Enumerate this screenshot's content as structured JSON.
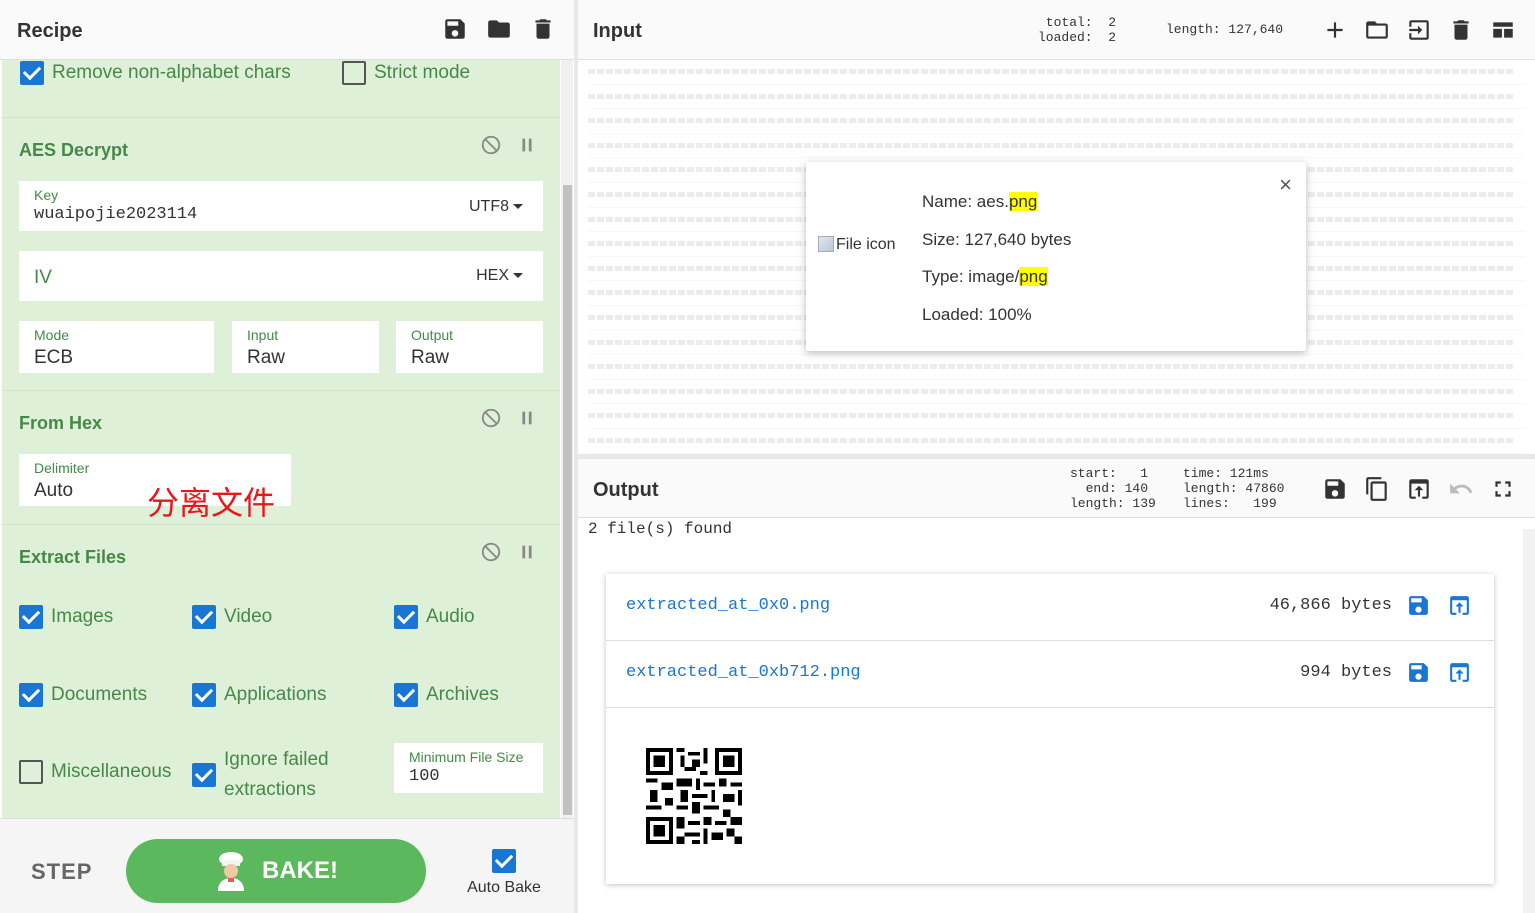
{
  "recipe": {
    "title": "Recipe",
    "top_checks": [
      {
        "label": "Remove non-alphabet chars",
        "checked": true
      },
      {
        "label": "Strict mode",
        "checked": false
      }
    ],
    "aes": {
      "title": "AES Decrypt",
      "key_label": "Key",
      "key_value": "wuaipojie2023114",
      "key_encoding": "UTF8",
      "iv_label": "IV",
      "iv_encoding": "HEX",
      "mode_label": "Mode",
      "mode_value": "ECB",
      "input_label": "Input",
      "input_value": "Raw",
      "output_label": "Output",
      "output_value": "Raw"
    },
    "from_hex": {
      "title": "From Hex",
      "delimiter_label": "Delimiter",
      "delimiter_value": "Auto"
    },
    "extract": {
      "title": "Extract Files",
      "annotation": "分离文件",
      "options": [
        {
          "label": "Images",
          "checked": true
        },
        {
          "label": "Video",
          "checked": true
        },
        {
          "label": "Audio",
          "checked": true
        },
        {
          "label": "Documents",
          "checked": true
        },
        {
          "label": "Applications",
          "checked": true
        },
        {
          "label": "Archives",
          "checked": true
        },
        {
          "label": "Miscellaneous",
          "checked": false
        }
      ],
      "ignore_line1": "Ignore failed",
      "ignore_line2": "extractions",
      "ignore_checked": true,
      "min_size_label": "Minimum File Size",
      "min_size_value": "100"
    }
  },
  "controls": {
    "step": "STEP",
    "bake": "BAKE!",
    "auto_bake": "Auto Bake",
    "auto_bake_checked": true
  },
  "input": {
    "title": "Input",
    "stats": "total:  2\nloaded:  2",
    "length": "length: 127,640",
    "file": {
      "icon_alt": "File icon",
      "name_prefix": "Name: aes.",
      "name_hl": "png",
      "size": "Size: 127,640 bytes",
      "type_prefix": "Type: image/",
      "type_hl": "png",
      "loaded": "Loaded: 100%",
      "close": "×"
    }
  },
  "output": {
    "title": "Output",
    "stats_left": "start:   1\n  end: 140\nlength: 139",
    "stats_right": "time: 121ms\nlength: 47860\nlines:   199",
    "found": "2 file(s) found",
    "files": [
      {
        "name": "extracted_at_0x0.png",
        "size": "46,866 bytes"
      },
      {
        "name": "extracted_at_0xb712.png",
        "size": "994 bytes"
      }
    ]
  },
  "colors": {
    "op_bg": "#dff0d8",
    "op_title": "#468847",
    "bake": "#5cb85c",
    "accent": "#1976d2"
  }
}
